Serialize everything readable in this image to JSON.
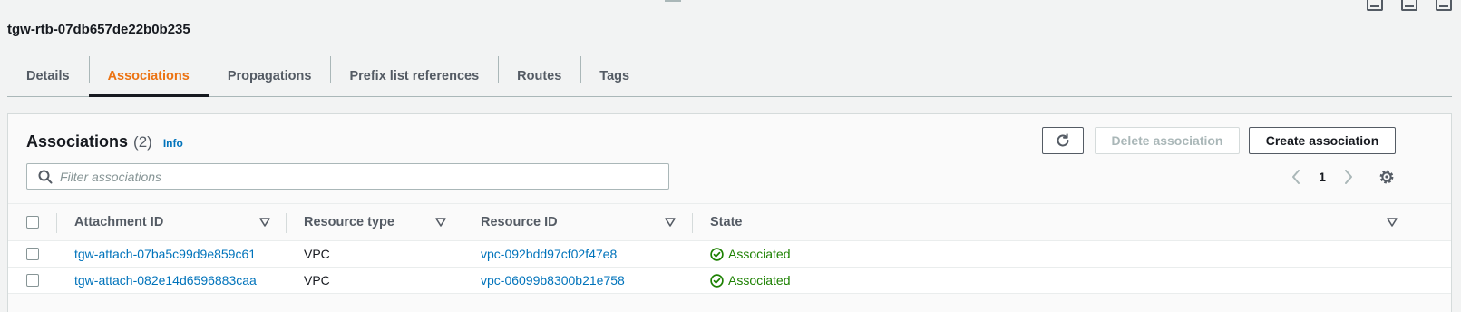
{
  "route_table": {
    "title": "tgw-rtb-07db657de22b0b235"
  },
  "tabs": [
    {
      "label": "Details"
    },
    {
      "label": "Associations"
    },
    {
      "label": "Propagations"
    },
    {
      "label": "Prefix list references"
    },
    {
      "label": "Routes"
    },
    {
      "label": "Tags"
    }
  ],
  "active_tab": "Associations",
  "panel": {
    "heading": "Associations",
    "count": "(2)",
    "info_label": "Info",
    "delete_label": "Delete association",
    "create_label": "Create association"
  },
  "filter": {
    "placeholder": "Filter associations",
    "value": ""
  },
  "pagination": {
    "current_page": "1"
  },
  "table": {
    "columns": {
      "attachment_id": "Attachment ID",
      "resource_type": "Resource type",
      "resource_id": "Resource ID",
      "state": "State"
    },
    "rows": [
      {
        "attachment_id": "tgw-attach-07ba5c99d9e859c61",
        "resource_type": "VPC",
        "resource_id": "vpc-092bdd97cf02f47e8",
        "state": "Associated"
      },
      {
        "attachment_id": "tgw-attach-082e14d6596883caa",
        "resource_type": "VPC",
        "resource_id": "vpc-06099b8300b21e758",
        "state": "Associated"
      }
    ]
  },
  "colors": {
    "active_tab": "#ec7211",
    "link": "#0073bb",
    "success": "#1d8102",
    "disabled": "#aab7b8"
  },
  "icons": [
    "search-icon",
    "refresh-icon",
    "chevron-left-icon",
    "chevron-right-icon",
    "settings-gear-icon",
    "sort-caret-icon",
    "success-check-icon"
  ]
}
